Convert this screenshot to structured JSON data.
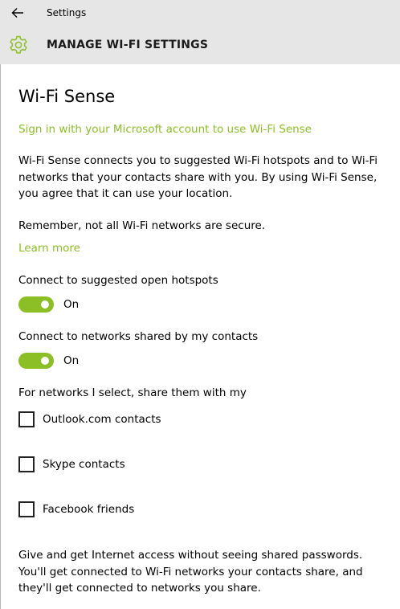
{
  "window": {
    "title": "Settings"
  },
  "header": {
    "title": "MANAGE WI-FI SETTINGS",
    "icon": "gear-icon",
    "accent": "#8cbf26"
  },
  "wifi_sense": {
    "heading": "Wi-Fi Sense",
    "sign_in_link": "Sign in with your Microsoft account to use Wi-Fi Sense",
    "description": "Wi-Fi Sense connects you to suggested Wi-Fi hotspots and to Wi-Fi networks that your contacts share with you. By using Wi-Fi Sense, you agree that it can use your location.",
    "reminder": "Remember, not all Wi-Fi networks are secure.",
    "learn_more": "Learn more",
    "toggles": [
      {
        "label": "Connect to suggested open hotspots",
        "state": "On",
        "on": true
      },
      {
        "label": "Connect to networks shared by my contacts",
        "state": "On",
        "on": true
      }
    ],
    "share_heading": "For networks I select, share them with my",
    "checkboxes": [
      {
        "label": "Outlook.com contacts",
        "checked": false
      },
      {
        "label": "Skype contacts",
        "checked": false
      },
      {
        "label": "Facebook friends",
        "checked": false
      }
    ],
    "footer": "Give and get Internet access without seeing shared passwords. You'll get connected to Wi-Fi networks your contacts share, and they'll get connected to networks you share."
  }
}
